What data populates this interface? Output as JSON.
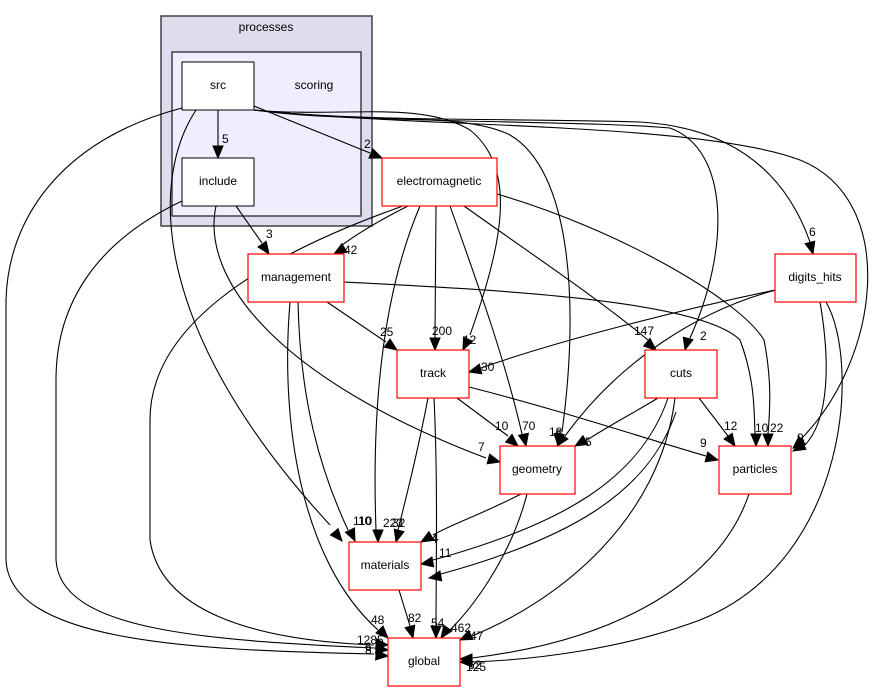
{
  "diagram": {
    "type": "directory-dependency-graph",
    "clusters": [
      {
        "id": "processes",
        "label": "processes"
      },
      {
        "id": "scoring",
        "label": "scoring"
      }
    ],
    "nodes": [
      {
        "id": "src",
        "label": "src",
        "kind": "local"
      },
      {
        "id": "include",
        "label": "include",
        "kind": "local"
      },
      {
        "id": "electromagnetic",
        "label": "electromagnetic",
        "kind": "external"
      },
      {
        "id": "management",
        "label": "management",
        "kind": "external"
      },
      {
        "id": "digits_hits",
        "label": "digits_hits",
        "kind": "external"
      },
      {
        "id": "track",
        "label": "track",
        "kind": "external"
      },
      {
        "id": "cuts",
        "label": "cuts",
        "kind": "external"
      },
      {
        "id": "geometry",
        "label": "geometry",
        "kind": "external"
      },
      {
        "id": "particles",
        "label": "particles",
        "kind": "external"
      },
      {
        "id": "materials",
        "label": "materials",
        "kind": "external"
      },
      {
        "id": "global",
        "label": "global",
        "kind": "external"
      }
    ],
    "edges": [
      {
        "from": "src",
        "to": "include",
        "label": "5"
      },
      {
        "from": "src",
        "to": "electromagnetic",
        "label": "2"
      },
      {
        "from": "src",
        "to": "digits_hits",
        "label": "6"
      },
      {
        "from": "src",
        "to": "track",
        "label": "12"
      },
      {
        "from": "src",
        "to": "cuts",
        "label": "2"
      },
      {
        "from": "src",
        "to": "geometry",
        "label": "18"
      },
      {
        "from": "src",
        "to": "particles",
        "label": "1"
      },
      {
        "from": "src",
        "to": "materials",
        "label": "110"
      },
      {
        "from": "src",
        "to": "global",
        "label": "6"
      },
      {
        "from": "include",
        "to": "management",
        "label": "3"
      },
      {
        "from": "include",
        "to": "geometry",
        "label": "7"
      },
      {
        "from": "include",
        "to": "global",
        "label": "8"
      },
      {
        "from": "electromagnetic",
        "to": "management",
        "label": "42"
      },
      {
        "from": "electromagnetic",
        "to": "track",
        "label": "200"
      },
      {
        "from": "electromagnetic",
        "to": "cuts",
        "label": "147"
      },
      {
        "from": "electromagnetic",
        "to": "geometry",
        "label": "70"
      },
      {
        "from": "electromagnetic",
        "to": "particles",
        "label": "22"
      },
      {
        "from": "electromagnetic",
        "to": "materials",
        "label": "223"
      },
      {
        "from": "electromagnetic",
        "to": "global",
        "label": "1285"
      },
      {
        "from": "management",
        "to": "track",
        "label": "25"
      },
      {
        "from": "management",
        "to": "particles",
        "label": "10"
      },
      {
        "from": "management",
        "to": "materials",
        "label": "10"
      },
      {
        "from": "management",
        "to": "global",
        "label": "48"
      },
      {
        "from": "digits_hits",
        "to": "track",
        "label": "30"
      },
      {
        "from": "digits_hits",
        "to": "geometry",
        "label": "6"
      },
      {
        "from": "digits_hits",
        "to": "particles",
        "label": "9"
      },
      {
        "from": "digits_hits",
        "to": "global",
        "label": "125"
      },
      {
        "from": "track",
        "to": "geometry",
        "label": "10"
      },
      {
        "from": "track",
        "to": "particles",
        "label": "9"
      },
      {
        "from": "track",
        "to": "materials",
        "label": "32"
      },
      {
        "from": "track",
        "to": "global",
        "label": "54"
      },
      {
        "from": "cuts",
        "to": "geometry",
        "label": "5"
      },
      {
        "from": "cuts",
        "to": "particles",
        "label": "12"
      },
      {
        "from": "cuts",
        "to": "materials",
        "label": "4"
      },
      {
        "from": "cuts",
        "to": "global",
        "label": "47"
      },
      {
        "from": "geometry",
        "to": "materials",
        "label": "4"
      },
      {
        "from": "geometry",
        "to": "global",
        "label": "462"
      },
      {
        "from": "materials",
        "to": "global",
        "label": "82"
      },
      {
        "from": "particles",
        "to": "global",
        "label": "62"
      },
      {
        "from": "cuts",
        "to": "materials",
        "label": "11"
      }
    ]
  },
  "colors": {
    "cluster_outer_fill": "#ddddee",
    "cluster_inner_fill": "#eeeeff",
    "local_node_border": "#000000",
    "external_node_border": "#ff0000",
    "edge": "#000000"
  }
}
